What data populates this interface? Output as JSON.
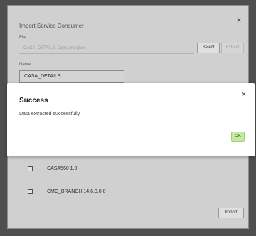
{
  "dialog": {
    "title": "Import Service Consumer",
    "close_icon": "×",
    "file_label": "File",
    "file_value": "CASA_DETAILS_Consumer.json",
    "select_label": "Select",
    "extract_label": "Extract",
    "name_label": "Name",
    "name_value": "CASA_DETAILS",
    "items": [
      {
        "label": "CASA560 1.0"
      },
      {
        "label": "CMC_BRANCH 14.6.0.0.0"
      }
    ],
    "import_label": "Import"
  },
  "success": {
    "title": "Success",
    "message": "Data extracted successfully.",
    "ok_label": "OK",
    "close_icon": "×"
  },
  "colors": {
    "ok_bg": "#c6e9a2",
    "ok_text": "#3d6a1b"
  }
}
